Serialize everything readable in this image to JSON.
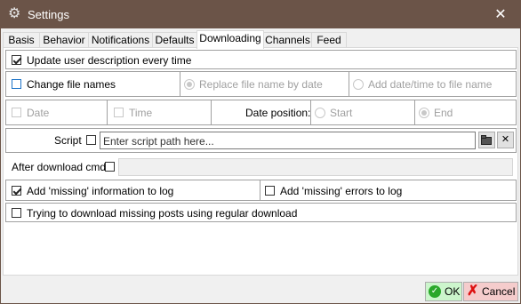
{
  "window": {
    "title": "Settings",
    "close_glyph": "✕",
    "app_icon": "gear-icon"
  },
  "tabs": [
    {
      "label": "Basis"
    },
    {
      "label": "Behavior"
    },
    {
      "label": "Notifications"
    },
    {
      "label": "Defaults"
    },
    {
      "label": "Downloading",
      "active": true
    },
    {
      "label": "Channels"
    },
    {
      "label": "Feed"
    }
  ],
  "options": {
    "update_user_description": {
      "label": "Update user description every time",
      "checked": true
    },
    "change_file_names": {
      "label": "Change file names",
      "checked": false
    },
    "replace_file_name_by_date": {
      "label": "Replace file name by date",
      "selected": true
    },
    "add_date_time_to_file_name": {
      "label": "Add date/time to file name",
      "selected": false
    },
    "date": {
      "label": "Date",
      "checked": false
    },
    "time": {
      "label": "Time",
      "checked": false
    },
    "date_position": {
      "label": "Date position:",
      "start_label": "Start",
      "end_label": "End",
      "selected": "End"
    },
    "script": {
      "label": "Script",
      "checked": false,
      "placeholder": "Enter script path here...",
      "value": ""
    },
    "after_download_cmd": {
      "label": "After download cmd",
      "checked": false,
      "value": ""
    },
    "add_missing_info_to_log": {
      "label": "Add 'missing' information to log",
      "checked": true
    },
    "add_missing_errors_to_log": {
      "label": "Add 'missing' errors to log",
      "checked": false
    },
    "download_missing_posts": {
      "label": "Trying to download missing posts using regular download",
      "checked": false
    }
  },
  "footer": {
    "ok_label": "OK",
    "cancel_label": "Cancel",
    "ok_color": "#ccf5cc",
    "cancel_color": "#f5cccc"
  },
  "icons": {
    "open_folder": "open-folder-icon",
    "clear": "clear-icon",
    "ok": "ok-check-icon",
    "cancel": "cancel-x-icon"
  }
}
